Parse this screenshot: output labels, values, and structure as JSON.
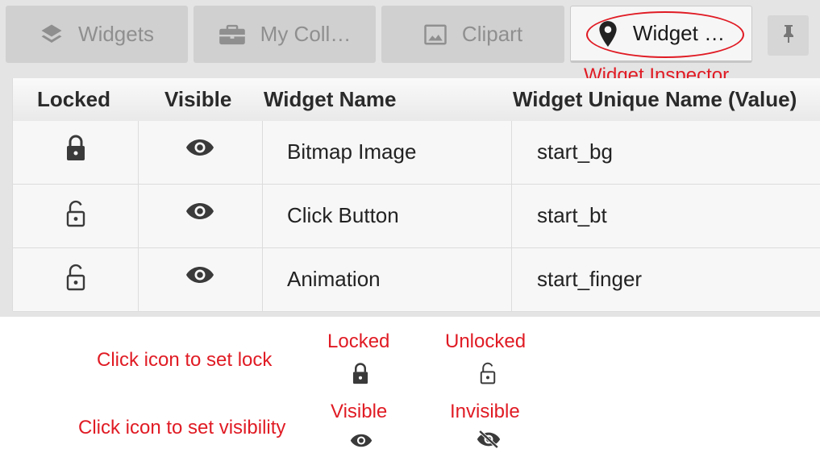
{
  "tabs": [
    {
      "label": "Widgets",
      "icon": "layers-icon"
    },
    {
      "label": "My Coll…",
      "icon": "briefcase-icon"
    },
    {
      "label": "Clipart",
      "icon": "image-icon"
    },
    {
      "label": "Widget …",
      "icon": "map-pin-icon",
      "active": true
    }
  ],
  "pin_icon": "pin-icon",
  "annotations": {
    "tab_callout": "Widget Inspector",
    "lock_hint": "Click icon to set lock",
    "visibility_hint": "Click icon to set visibility",
    "locked": "Locked",
    "unlocked": "Unlocked",
    "visible": "Visible",
    "invisible": "Invisible",
    "color": "#e01b24"
  },
  "table": {
    "columns": [
      "Locked",
      "Visible",
      "Widget Name",
      "Widget Unique Name (Value)"
    ],
    "rows": [
      {
        "locked": true,
        "visible": true,
        "name": "Bitmap Image",
        "value": "start_bg"
      },
      {
        "locked": false,
        "visible": true,
        "name": "Click Button",
        "value": "start_bt"
      },
      {
        "locked": false,
        "visible": true,
        "name": "Animation",
        "value": "start_finger"
      }
    ]
  }
}
